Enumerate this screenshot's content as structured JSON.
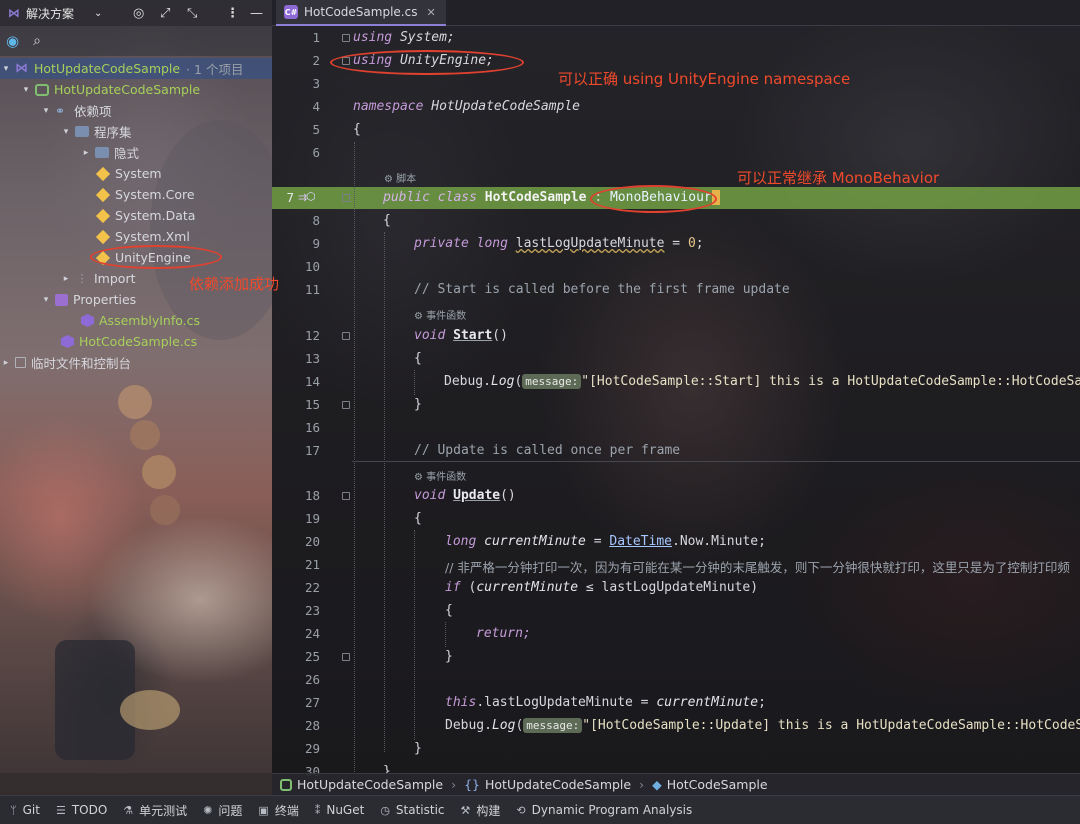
{
  "sidebar": {
    "title": "解决方案",
    "tree": {
      "solution": {
        "name": "HotUpdateCodeSample",
        "suffix": "· 1 个项目"
      },
      "project": "HotUpdateCodeSample",
      "dependencies": "依赖项",
      "assemblies": "程序集",
      "implicit": "隐式",
      "refs": [
        "System",
        "System.Core",
        "System.Data",
        "System.Xml",
        "UnityEngine"
      ],
      "import": "Import",
      "properties": "Properties",
      "assembly_info": "AssemblyInfo.cs",
      "main_file": "HotCodeSample.cs",
      "scratches": "临时文件和控制台"
    }
  },
  "editor": {
    "tab": "HotCodeSample.cs",
    "line_numbers": [
      "1",
      "2",
      "3",
      "4",
      "5",
      "6",
      "7",
      "8",
      "9",
      "10",
      "11",
      "12",
      "13",
      "14",
      "15",
      "16",
      "17",
      "18",
      "19",
      "20",
      "21",
      "22",
      "23",
      "24",
      "25",
      "26",
      "27",
      "28",
      "29",
      "30"
    ],
    "inlay_script": "脚本",
    "inlay_event1": "事件函数",
    "inlay_event2": "事件函数",
    "param_hint": "message:",
    "code": {
      "l1_kw": "using",
      "l1_ns": "System;",
      "l2_kw": "using",
      "l2_ns": "UnityEngine;",
      "l4_kw": "namespace",
      "l4_ns": "HotUpdateCodeSample",
      "l5": "{",
      "l7_kw": "public class",
      "l7_name": "HotCodeSample",
      "l7_colon": ":",
      "l7_base": "MonoBehaviour",
      "l8": "{",
      "l9_kw": "private long",
      "l9_var": "lastLogUpdateMinute",
      "l9_rest": " = ",
      "l9_num": "0",
      "l9_end": ";",
      "l11": "// Start is called before the first frame update",
      "l12_kw": "void",
      "l12_fn": "Start",
      "l12_rest": "()",
      "l13": "{",
      "l14_a": "Debug.",
      "l14_m": "Log",
      "l14_b": "(",
      "l14_str": "\"[HotCodeSample::Start] this is a HotUpdateCodeSample::HotCodeSam",
      "l15": "}",
      "l17": "// Update is called once per frame",
      "l18_kw": "void",
      "l18_fn": "Update",
      "l18_rest": "()",
      "l19": "{",
      "l20_kw": "long",
      "l20_var": "currentMinute",
      "l20_eq": " = ",
      "l20_type": "DateTime",
      "l20_rest": ".Now.Minute;",
      "l21": "// 非严格一分钟打印一次，因为有可能在某一分钟的末尾触发，则下一分钟很快就打印，这里只是为了控制打印频",
      "l22_kw": "if",
      "l22_a": " (",
      "l22_var": "currentMinute",
      "l22_op": " ≤ ",
      "l22_b": "lastLogUpdateMinute)",
      "l23": "{",
      "l24": "return;",
      "l25": "}",
      "l27_kw": "this",
      "l27_a": ".lastLogUpdateMinute = ",
      "l27_var": "currentMinute",
      "l27_b": ";",
      "l28_a": "Debug.",
      "l28_m": "Log",
      "l28_b": "(",
      "l28_str": "\"[HotCodeSample::Update] this is a HotUpdateCodeSample::HotCodeSan",
      "l29": "}",
      "l30": "}"
    }
  },
  "annotations": {
    "namespace_note": "可以正确 using UnityEngine namespace",
    "inherit_note": "可以正常继承 MonoBehavior",
    "dependency_note": "依赖添加成功"
  },
  "breadcrumb": [
    "HotUpdateCodeSample",
    "HotUpdateCodeSample",
    "HotCodeSample"
  ],
  "statusbar": [
    "Git",
    "TODO",
    "单元测试",
    "问题",
    "终端",
    "NuGet",
    "Statistic",
    "构建",
    "Dynamic Program Analysis"
  ],
  "colors": {
    "annotation": "#e1412f",
    "highlight": "#78aa46",
    "accent": "#8e6ad7"
  }
}
